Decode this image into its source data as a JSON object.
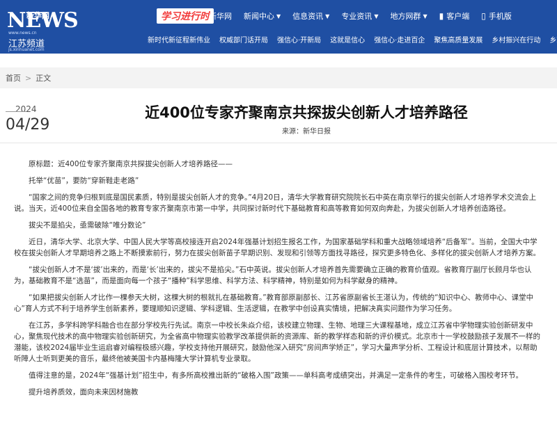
{
  "header": {
    "logo_text": "新华网",
    "logo_sub": "NEWS",
    "logo_url": "www.news.cn",
    "channel": "江苏频道",
    "channel_url": "js.xinhuanet.com",
    "brand": "学习进行时",
    "nav": [
      {
        "label": "新华网",
        "caret": false
      },
      {
        "label": "新闻中心",
        "caret": true
      },
      {
        "label": "信息资讯",
        "caret": true
      },
      {
        "label": "专业资讯",
        "caret": true
      },
      {
        "label": "地方网群",
        "caret": true
      },
      {
        "label": "客户端",
        "icon": "▮"
      },
      {
        "label": "手机版",
        "icon": "▯"
      }
    ],
    "subnav": [
      "新时代新征程新伟业",
      "权威部门话开局",
      "强信心·开新局",
      "这就是信心",
      "强信心·走进百企",
      "聚焦高质量发展",
      "乡村振兴在行动",
      "乡环"
    ]
  },
  "breadcrumb": {
    "home": "首页",
    "sep": ">",
    "current": "正文"
  },
  "date": {
    "year": "2024",
    "month_day": "04/29"
  },
  "article": {
    "title": "近400位专家齐聚南京共探拔尖创新人才培养路径",
    "source": "来源：新华日报",
    "paragraphs": [
      "原标题：近400位专家齐聚南京共探拔尖创新人才培养路径——",
      "托举“优苗”，要防“穿新鞋走老路”",
      "“国家之间的竞争归根到底是国民素质，特别是拔尖创新人才的竞争。”4月20日，清华大学教育研究院院长石中英在南京举行的拔尖创新人才培养学术交流会上说。当天，近400位来自全国各地的教育专家齐聚南京市第一中学，共同探讨新时代下基础教育和高等教育如何双向奔赴，为拔尖创新人才培养创造路径。",
      "拔尖不是掐尖，亟需破除“唯分数论”",
      "近日，清华大学、北京大学、中国人民大学等高校接连开启2024年强基计划招生报名工作，为国家基础学科和重大战略领域培养“后备军”。当前，全国大中学校在拔尖创新人才早期培养之路上不断摸索前行，努力在拔尖创新苗子早期识别、发现和引领等方面找寻路径，探究更多特色化、多样化的拔尖创新人才培养方案。",
      "“拔尖创新人才不是‘拔’出来的，而是‘长’出来的，拔尖不是掐尖。”石中英说。拔尖创新人才培养首先需要确立正确的教育价值观。省教育厅副厅长顾月华也认为，基础教育不是“选苗”，而是面向每一个孩子“播种”科学思维、科学方法、科学精神，特别是如何为科学献身的精神。",
      "“如果把拔尖创新人才比作一棵参天大树，这棵大树的根就扎在基础教育。”教育部原副部长、江苏省原副省长王湛认为，传统的“知识中心、教师中心、课堂中心”育人方式不利于培养学生创新素养，要理顺知识逻辑、学科逻辑、生活逻辑，在教学中创设真实情境，把解决真实问题作为学习任务。",
      "在江苏，多学科跨学科融合也在部分学校先行先试。南京一中校长朱焱介绍，该校建立物理、生物、地理三大课程基地，成立江苏省中学物理实验创新研发中心，聚焦现代技术的高中物理实验创新研究，为全省高中物理实验教学改革提供新的资源库、新的教学样态和新的评价模式。北京市十一学校鼓励孩子发展不一样的潜能，该校2024届毕业生运启睿对编程极感兴趣，学校支持他开展研究，鼓励他深入研究“房间声学矫正”，学习大量声学分析、工程设计和底层计算技术，以帮助听障人士听到更美的音乐，最终他被美国卡内基梅隆大学计算机专业录取。",
      "值得注意的是，2024年“强基计划”招生中，有多所高校推出新的“破格入围”政策——单科高考成绩突出，并满足一定条件的考生，可破格入围校考环节。",
      "提升培养质效，面向未来因材施教"
    ]
  }
}
